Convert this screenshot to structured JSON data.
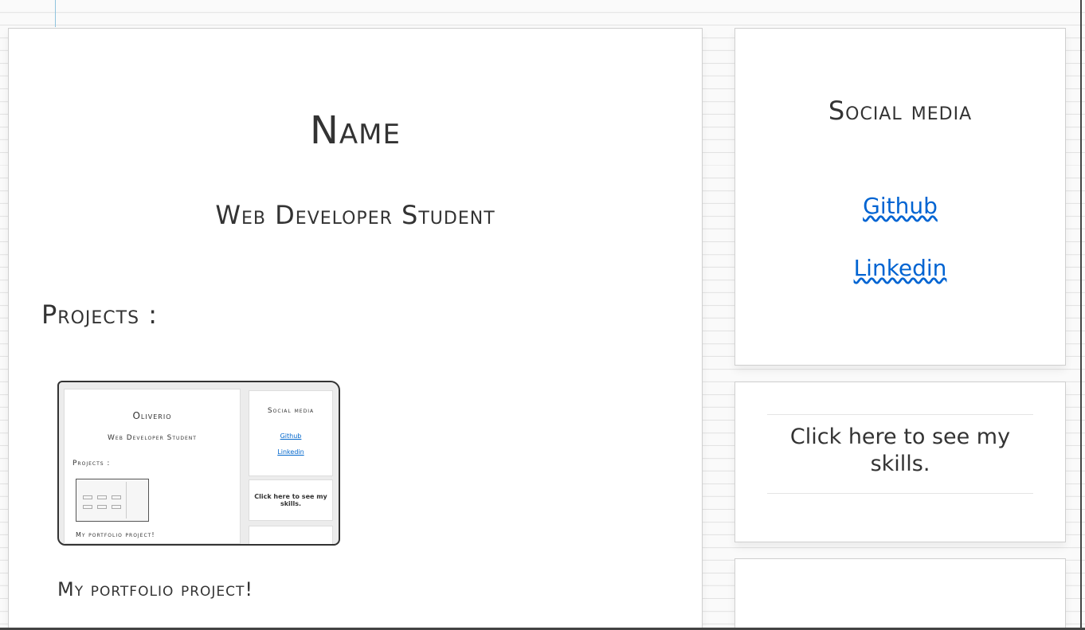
{
  "main": {
    "name": "Name",
    "role": "Web Developer Student",
    "projects_heading": "Projects :",
    "project_caption": "My portfolio project!"
  },
  "thumbnail": {
    "name": "Oliverio",
    "role": "Web Developer Student",
    "projects_heading": "Projects :",
    "caption": "My portfolio project!",
    "social_heading": "Social media",
    "github": "Github",
    "linkedin": "Linkedin",
    "skills": "Click here to see my skills."
  },
  "social": {
    "heading": "Social media",
    "links": [
      "Github",
      "Linkedin"
    ]
  },
  "skills": {
    "text": "Click here to see my skills."
  },
  "colors": {
    "link": "#0064d2",
    "text": "#333333",
    "page_lines": "#e2e2e2"
  }
}
